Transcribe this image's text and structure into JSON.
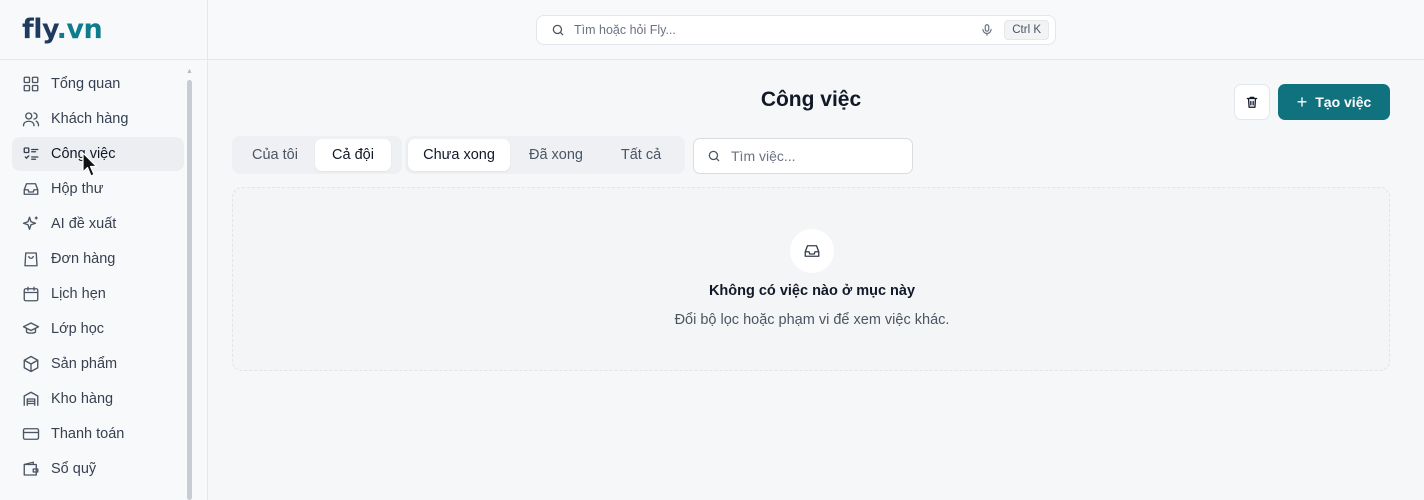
{
  "logo": {
    "part1": "fly",
    "part2": ".vn"
  },
  "sidebar": {
    "items": [
      {
        "label": "Tổng quan",
        "icon": "grid-icon"
      },
      {
        "label": "Khách hàng",
        "icon": "users-icon"
      },
      {
        "label": "Công việc",
        "icon": "task-list-icon",
        "active": true
      },
      {
        "label": "Hộp thư",
        "icon": "inbox-icon"
      },
      {
        "label": "AI đề xuất",
        "icon": "sparkles-icon"
      },
      {
        "label": "Đơn hàng",
        "icon": "shopping-bag-icon"
      },
      {
        "label": "Lịch hẹn",
        "icon": "calendar-icon"
      },
      {
        "label": "Lớp học",
        "icon": "graduation-cap-icon"
      },
      {
        "label": "Sản phẩm",
        "icon": "package-icon"
      },
      {
        "label": "Kho hàng",
        "icon": "warehouse-icon"
      },
      {
        "label": "Thanh toán",
        "icon": "credit-card-icon"
      },
      {
        "label": "Sổ quỹ",
        "icon": "wallet-icon"
      }
    ]
  },
  "topbar": {
    "search_placeholder": "Tìm hoặc hỏi Fly...",
    "shortcut": "Ctrl K"
  },
  "main": {
    "title": "Công việc",
    "create_label": "Tạo việc",
    "scope_tabs": [
      {
        "label": "Của tôi",
        "selected": false
      },
      {
        "label": "Cả đội",
        "selected": true
      }
    ],
    "status_tabs": [
      {
        "label": "Chưa xong",
        "selected": true
      },
      {
        "label": "Đã xong",
        "selected": false
      },
      {
        "label": "Tất cả",
        "selected": false
      }
    ],
    "task_search_placeholder": "Tìm việc...",
    "empty": {
      "title": "Không có việc nào ở mục này",
      "subtitle": "Đổi bộ lọc hoặc phạm vi để xem việc khác."
    }
  },
  "colors": {
    "accent": "#11727f",
    "logo_dark": "#1e3a5f",
    "logo_accent": "#0e7c8c"
  }
}
